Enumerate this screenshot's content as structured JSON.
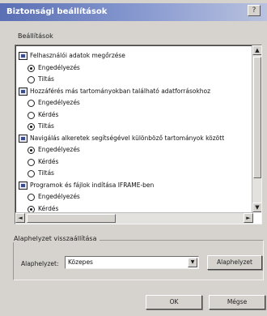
{
  "window": {
    "title": "Biztonsági beállítások",
    "help_glyph": "?"
  },
  "settings": {
    "label": "Beállítások",
    "rows": [
      {
        "kind": "category",
        "text": "Felhasználói adatok megőrzése"
      },
      {
        "kind": "option",
        "text": "Engedélyezés",
        "checked": true
      },
      {
        "kind": "option",
        "text": "Tiltás",
        "checked": false
      },
      {
        "kind": "category",
        "text": "Hozzáférés más tartományokban található adatforrásokhoz"
      },
      {
        "kind": "option",
        "text": "Engedélyezés",
        "checked": false
      },
      {
        "kind": "option",
        "text": "Kérdés",
        "checked": false
      },
      {
        "kind": "option",
        "text": "Tiltás",
        "checked": true
      },
      {
        "kind": "category",
        "text": "Navigálás alkeretek segítségével különböző tartományok között"
      },
      {
        "kind": "option",
        "text": "Engedélyezés",
        "checked": true
      },
      {
        "kind": "option",
        "text": "Kérdés",
        "checked": false
      },
      {
        "kind": "option",
        "text": "Tiltás",
        "checked": false
      },
      {
        "kind": "category",
        "text": "Programok és fájlok indítása IFRAME-ben"
      },
      {
        "kind": "option",
        "text": "Engedélyezés",
        "checked": false
      },
      {
        "kind": "option",
        "text": "Kérdés",
        "checked": true
      }
    ]
  },
  "scroll": {
    "up": "▲",
    "down": "▼",
    "left": "◄",
    "right": "►"
  },
  "reset": {
    "group_title": "Alaphelyzet visszaállítása",
    "field_label": "Alaphelyzet:",
    "selected": "Közepes",
    "dropdown_arrow": "▼",
    "button_label": "Alaphelyzet"
  },
  "footer": {
    "ok_label": "OK",
    "cancel_label": "Mégse"
  }
}
